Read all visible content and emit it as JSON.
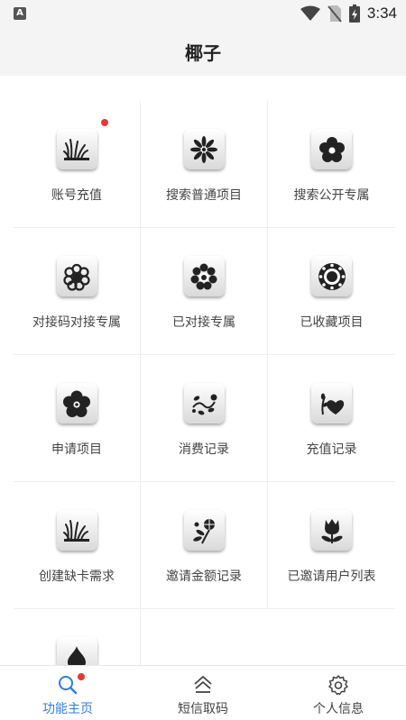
{
  "status_bar": {
    "notification_badge": "A",
    "time": "3:34"
  },
  "header": {
    "title": "椰子"
  },
  "grid": {
    "items": [
      {
        "label": "账号充值",
        "icon": "grass-icon",
        "badge": true
      },
      {
        "label": "搜索普通项目",
        "icon": "daisy-icon",
        "badge": false
      },
      {
        "label": "搜索公开专属",
        "icon": "flower-icon",
        "badge": false
      },
      {
        "label": "对接码对接专属",
        "icon": "chrysanthemum-icon",
        "badge": false
      },
      {
        "label": "已对接专属",
        "icon": "dahlia-icon",
        "badge": false
      },
      {
        "label": "已收藏项目",
        "icon": "sunflower-icon",
        "badge": false
      },
      {
        "label": "申请项目",
        "icon": "flower-icon",
        "badge": false
      },
      {
        "label": "消费记录",
        "icon": "vine-icon",
        "badge": false
      },
      {
        "label": "充值记录",
        "icon": "heart-plant-icon",
        "badge": false
      },
      {
        "label": "创建缺卡需求",
        "icon": "grass-icon",
        "badge": false
      },
      {
        "label": "邀请金额记录",
        "icon": "thistle-icon",
        "badge": false
      },
      {
        "label": "已邀请用户列表",
        "icon": "tulip-icon",
        "badge": false
      },
      {
        "label": "",
        "icon": "spade-leaf-icon",
        "badge": false
      }
    ]
  },
  "bottom_nav": {
    "items": [
      {
        "label": "功能主页",
        "icon": "search-icon",
        "active": true
      },
      {
        "label": "短信取码",
        "icon": "home-icon",
        "active": false
      },
      {
        "label": "个人信息",
        "icon": "gear-icon",
        "active": false
      }
    ]
  },
  "colors": {
    "accent": "#2f7de1",
    "badge": "#e53935",
    "icon_fill": "#222222"
  }
}
